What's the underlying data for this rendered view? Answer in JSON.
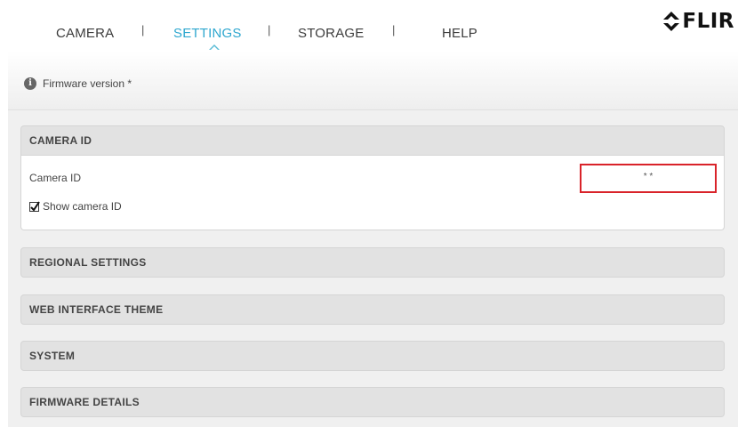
{
  "nav": {
    "tabs": [
      {
        "label": "CAMERA",
        "active": false
      },
      {
        "label": "SETTINGS",
        "active": true
      },
      {
        "label": "STORAGE",
        "active": false
      },
      {
        "label": "HELP",
        "active": false
      }
    ],
    "separator": "|",
    "brand": "FLIR",
    "logo_icon": "flir-diamond-logo-icon"
  },
  "info": {
    "icon": "info-icon",
    "icon_glyph": "i",
    "text": "Firmware version *"
  },
  "panels": {
    "camera_id": {
      "title": "CAMERA ID",
      "field_label": "Camera ID",
      "field_value": "* *",
      "checkbox_label": "Show camera ID",
      "checkbox_checked": true
    },
    "regional": {
      "title": "REGIONAL SETTINGS"
    },
    "theme": {
      "title": "WEB INTERFACE THEME"
    },
    "system": {
      "title": "SYSTEM"
    },
    "firmware": {
      "title": "FIRMWARE DETAILS"
    }
  },
  "colors": {
    "accent": "#2ea7cf",
    "highlight_border": "#d9232a",
    "panel_header_bg": "#e2e2e2",
    "content_bg": "#f0f0f0"
  }
}
